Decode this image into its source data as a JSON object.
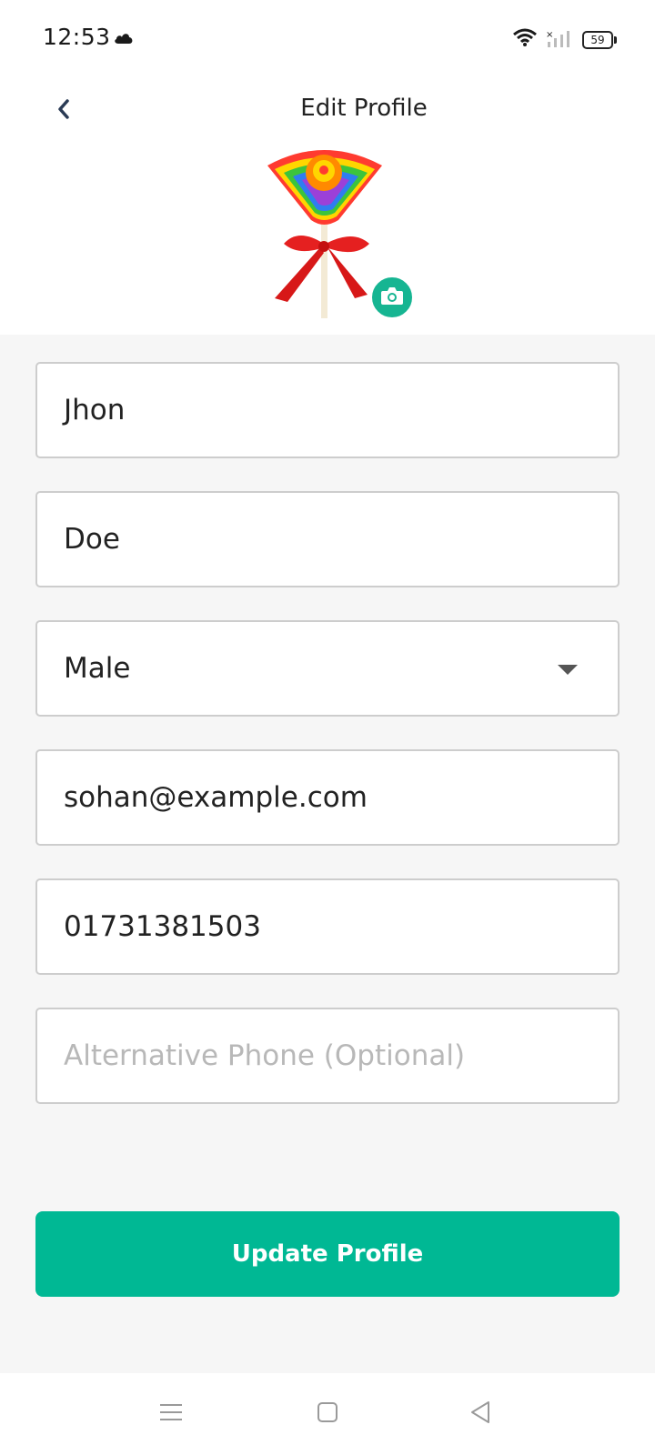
{
  "status_bar": {
    "time": "12:53",
    "battery": "59",
    "icons": [
      "cloud-icon",
      "wifi-icon",
      "signal-icon",
      "battery-icon"
    ]
  },
  "header": {
    "title": "Edit Profile",
    "back_icon": "chevron-left-icon"
  },
  "avatar": {
    "image": "lollipop",
    "camera_icon": "camera-icon",
    "accent": "#16b592"
  },
  "form": {
    "first_name": "Jhon",
    "last_name": "Doe",
    "gender": "Male",
    "email": "sohan@example.com",
    "phone": "01731381503",
    "alt_phone_placeholder": "Alternative Phone (Optional)"
  },
  "actions": {
    "update_label": "Update Profile",
    "button_color": "#00b894"
  },
  "nav": {
    "icons": [
      "menu-icon",
      "home-icon",
      "back-icon"
    ]
  }
}
